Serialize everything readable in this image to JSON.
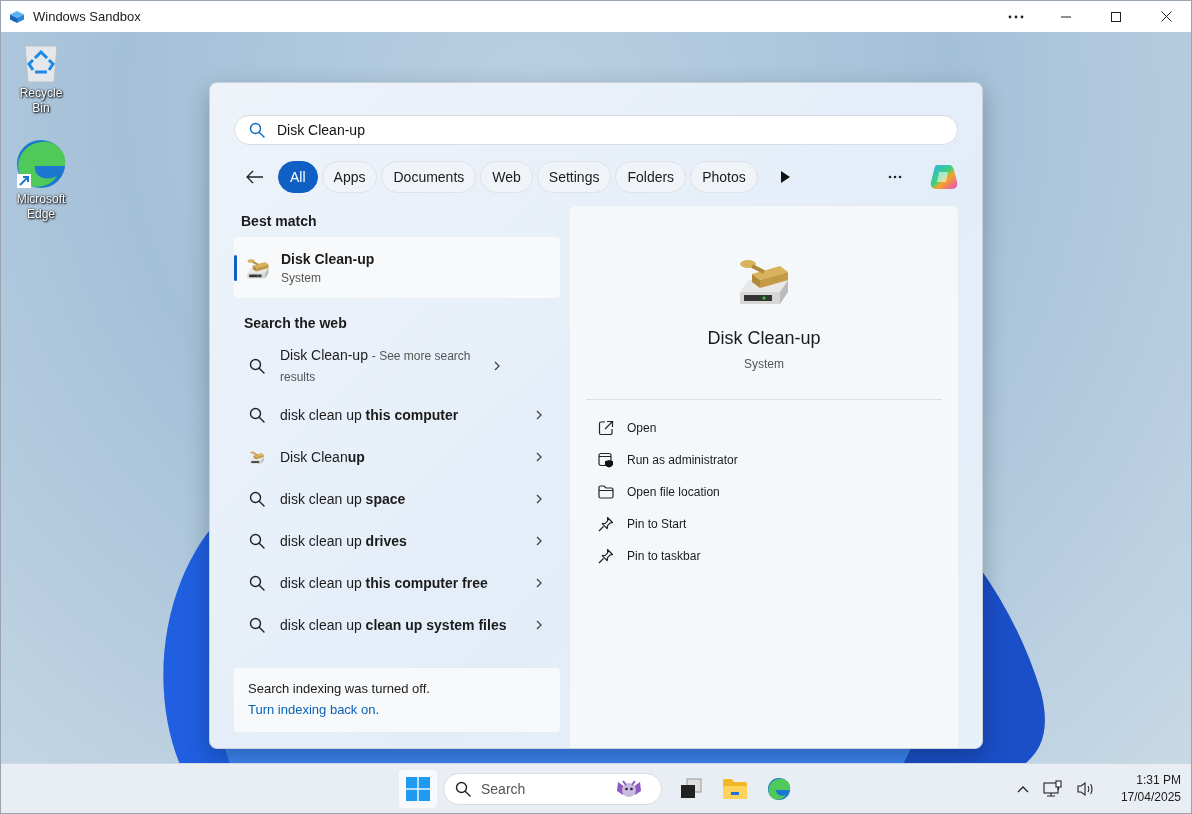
{
  "window": {
    "title": "Windows Sandbox"
  },
  "desktop_icons": [
    {
      "kind": "recycle",
      "label": "Recycle Bin"
    },
    {
      "kind": "edge",
      "label": "Microsoft Edge"
    }
  ],
  "search": {
    "value": "Disk Clean-up"
  },
  "filters": [
    {
      "label": "All",
      "selected": true
    },
    {
      "label": "Apps",
      "selected": false
    },
    {
      "label": "Documents",
      "selected": false
    },
    {
      "label": "Web",
      "selected": false
    },
    {
      "label": "Settings",
      "selected": false
    },
    {
      "label": "Folders",
      "selected": false
    },
    {
      "label": "Photos",
      "selected": false
    }
  ],
  "best_match": {
    "heading": "Best match",
    "title": "Disk Clean-up",
    "subtitle": "System",
    "selected": true
  },
  "web": {
    "heading": "Search the web",
    "results": [
      {
        "kind": "search",
        "text": "Disk Clean-up",
        "suffix": "- See more search results"
      },
      {
        "kind": "search",
        "text": "disk clean up **this computer**"
      },
      {
        "kind": "app",
        "text": "Disk Clean**up**"
      },
      {
        "kind": "search",
        "text": "disk clean up **space**"
      },
      {
        "kind": "search",
        "text": "disk clean up **drives**"
      },
      {
        "kind": "search",
        "text": "disk clean up **this computer free**"
      },
      {
        "kind": "search",
        "text": "disk clean up **clean up system files**"
      }
    ]
  },
  "notice": {
    "text": "Search indexing was turned off.",
    "link": "Turn indexing back on."
  },
  "details": {
    "title": "Disk Clean-up",
    "subtitle": "System",
    "actions": [
      {
        "kind": "open",
        "label": "Open"
      },
      {
        "kind": "admin",
        "label": "Run as administrator"
      },
      {
        "kind": "folder",
        "label": "Open file location"
      },
      {
        "kind": "pin",
        "label": "Pin to Start"
      },
      {
        "kind": "pin",
        "label": "Pin to taskbar"
      }
    ]
  },
  "taskbar": {
    "search_placeholder": "Search",
    "time": "1:31 PM",
    "date": "17/04/2025"
  }
}
